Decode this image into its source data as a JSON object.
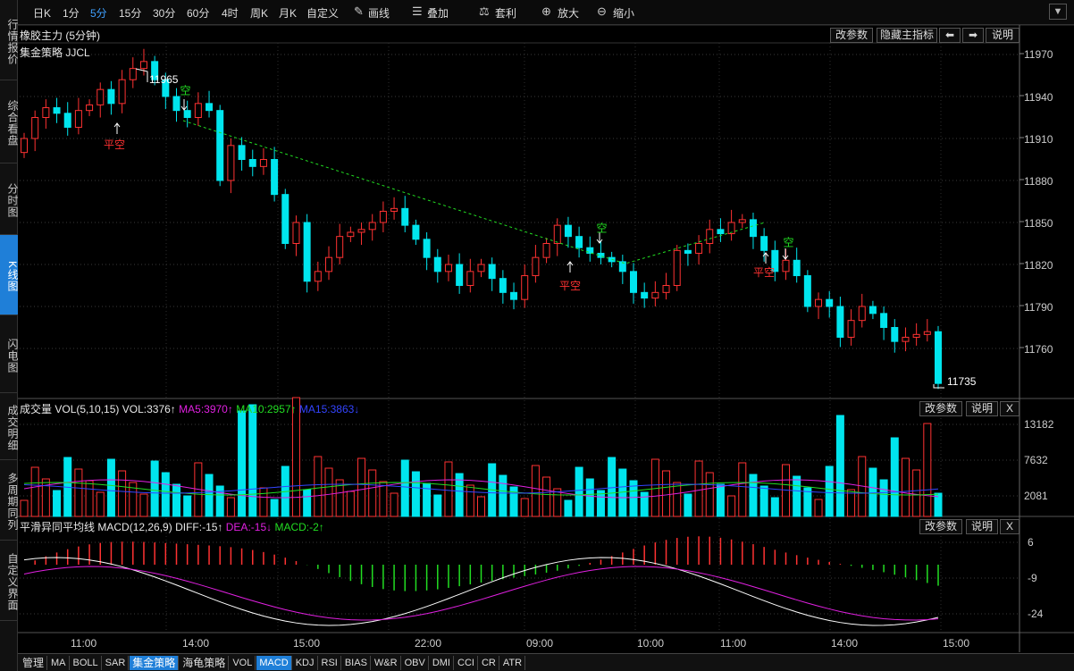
{
  "sidebar": {
    "tabs": [
      {
        "label": "行情报价",
        "active": false
      },
      {
        "label": "综合看盘",
        "active": false
      },
      {
        "label": "分时图",
        "active": false
      },
      {
        "label": "K线图",
        "active": true
      },
      {
        "label": "闪电图",
        "active": false
      },
      {
        "label": "成交明细",
        "active": false
      },
      {
        "label": "多周期同列",
        "active": false
      },
      {
        "label": "自定义界面",
        "active": false
      }
    ]
  },
  "toolbar": {
    "periods": [
      "日K",
      "1分",
      "5分",
      "15分",
      "30分",
      "60分",
      "4时",
      "周K",
      "月K",
      "自定义"
    ],
    "selected_period": "5分",
    "draw": "画线",
    "overlay": "叠加",
    "arbitrage": "套利",
    "zoom_in": "放大",
    "zoom_out": "缩小"
  },
  "main_panel": {
    "title": "橡胶主力 (5分钟)",
    "strategy": "集金策略 JJCL",
    "buttons": {
      "params": "改参数",
      "hide": "隐藏主指标",
      "help": "说明",
      "left": "⬅",
      "right": "➡"
    },
    "y_ticks": [
      "11970",
      "11940",
      "11910",
      "11880",
      "11850",
      "11820",
      "11790",
      "11760"
    ],
    "high_label": "11965",
    "low_label": "11735",
    "signal_labels": {
      "flat_short": "平空",
      "short": "空"
    }
  },
  "volume_panel": {
    "title": "成交量",
    "indicator": "VOL(5,10,15)",
    "vol": "VOL:3376↑",
    "ma5": "MA5:3970↑",
    "ma10": "MA10:2957↑",
    "ma15": "MA15:3863↓",
    "y_ticks": [
      "13182",
      "7632",
      "2081"
    ],
    "buttons": {
      "params": "改参数",
      "help": "说明",
      "close": "X"
    }
  },
  "macd_panel": {
    "title": "平滑异同平均线",
    "indicator": "MACD(12,26,9)",
    "diff": "DIFF:-15↑",
    "dea": "DEA:-15↓",
    "macd": "MACD:-2↑",
    "y_ticks": [
      "6",
      "-9",
      "-24"
    ],
    "buttons": {
      "params": "改参数",
      "help": "说明",
      "close": "X"
    }
  },
  "time_axis": [
    "11:00",
    "14:00",
    "15:00",
    "22:00",
    "09:00",
    "10:00",
    "11:00",
    "14:00",
    "15:00"
  ],
  "bottom_tabs": [
    {
      "label": "管理",
      "active": false
    },
    {
      "label": "MA",
      "active": false
    },
    {
      "label": "BOLL",
      "active": false
    },
    {
      "label": "SAR",
      "active": false
    },
    {
      "label": "集金策略",
      "active": true
    },
    {
      "label": "海龟策略",
      "active": false
    },
    {
      "label": "VOL",
      "active": false
    },
    {
      "label": "MACD",
      "active": true
    },
    {
      "label": "KDJ",
      "active": false
    },
    {
      "label": "RSI",
      "active": false
    },
    {
      "label": "BIAS",
      "active": false
    },
    {
      "label": "W&R",
      "active": false
    },
    {
      "label": "OBV",
      "active": false
    },
    {
      "label": "DMI",
      "active": false
    },
    {
      "label": "CCI",
      "active": false
    },
    {
      "label": "CR",
      "active": false
    },
    {
      "label": "ATR",
      "active": false
    }
  ],
  "colors": {
    "up": "#ff3232",
    "down": "#00e5ee",
    "dif": "#ffffff",
    "dea": "#e020e0",
    "ma10": "#22dd22",
    "ma15": "#3344ff",
    "signal_red": "#ff3232",
    "signal_green": "#22dd22"
  }
}
